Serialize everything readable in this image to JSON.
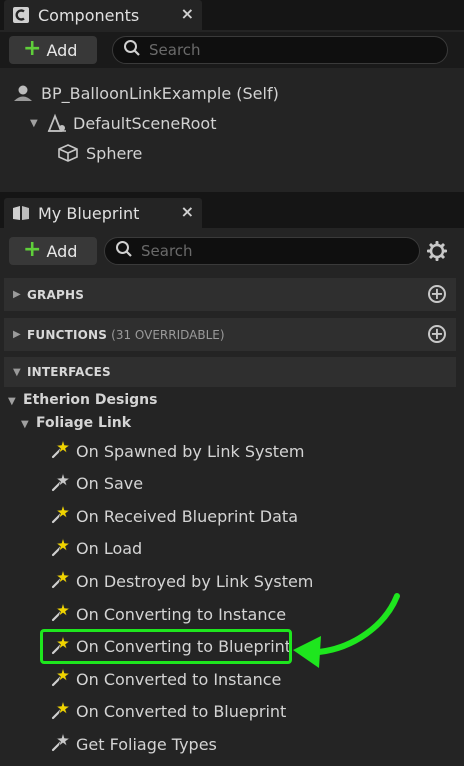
{
  "components": {
    "tab_title": "Components",
    "close_glyph": "×",
    "add_label": "Add",
    "search_placeholder": "Search",
    "tree": [
      {
        "label": "BP_BalloonLinkExample (Self)",
        "icon": "self-icon"
      },
      {
        "label": "DefaultSceneRoot",
        "icon": "scene-root-icon"
      },
      {
        "label": "Sphere",
        "icon": "cube-icon"
      }
    ]
  },
  "my_blueprint": {
    "tab_title": "My Blueprint",
    "close_glyph": "×",
    "add_label": "Add",
    "search_placeholder": "Search",
    "sections": [
      {
        "title": "GRAPHS",
        "subtitle": ""
      },
      {
        "title": "FUNCTIONS",
        "subtitle": "(31 OVERRIDABLE)"
      },
      {
        "title": "INTERFACES",
        "subtitle": ""
      }
    ],
    "interfaces": {
      "category": "Etherion Designs",
      "subcategory": "Foliage Link",
      "functions": [
        {
          "label": "On Spawned by Link System",
          "icon": "event-icon"
        },
        {
          "label": "On Save",
          "icon": "function-icon"
        },
        {
          "label": "On Received Blueprint Data",
          "icon": "event-icon"
        },
        {
          "label": "On Load",
          "icon": "event-icon"
        },
        {
          "label": "On Destroyed by Link System",
          "icon": "event-icon"
        },
        {
          "label": "On Converting to Instance",
          "icon": "event-icon"
        },
        {
          "label": "On Converting to Blueprint",
          "icon": "event-icon"
        },
        {
          "label": "On Converted to Instance",
          "icon": "event-icon"
        },
        {
          "label": "On Converted to Blueprint",
          "icon": "event-icon"
        },
        {
          "label": "Get Foliage Types",
          "icon": "function-icon"
        }
      ],
      "highlighted_item": "On Converting to Blueprint"
    }
  },
  "colors": {
    "highlight": "#1ee61e",
    "event_icon": "#f0d400",
    "add_plus": "#5fcf3a"
  }
}
